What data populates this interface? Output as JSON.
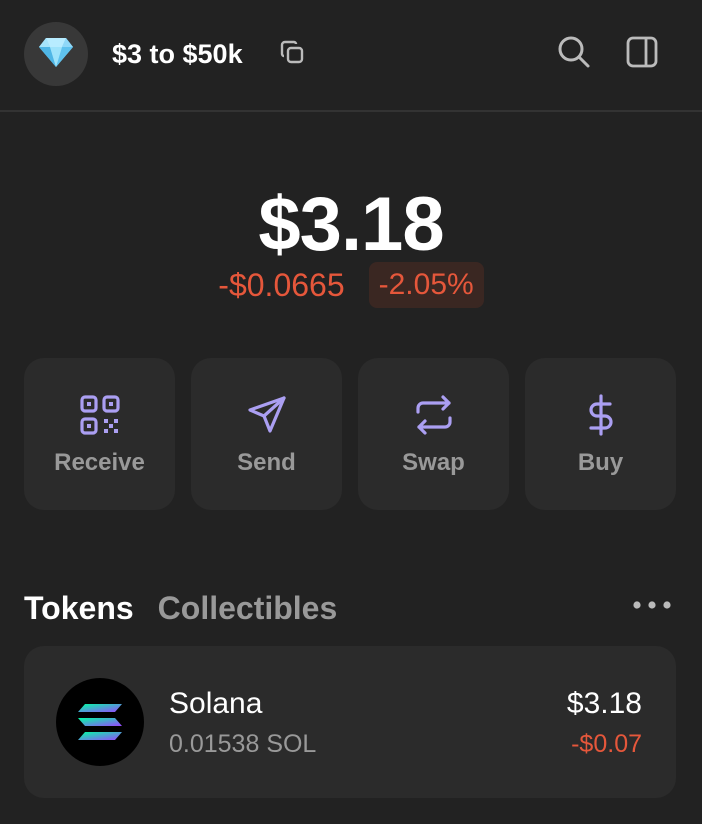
{
  "header": {
    "account_name": "$3 to $50k",
    "avatar_icon": "diamond-icon"
  },
  "balance": {
    "total": "$3.18",
    "change_amount": "-$0.0665",
    "change_percent": "-2.05%"
  },
  "actions": [
    {
      "label": "Receive",
      "icon": "qr-code-icon"
    },
    {
      "label": "Send",
      "icon": "send-icon"
    },
    {
      "label": "Swap",
      "icon": "swap-icon"
    },
    {
      "label": "Buy",
      "icon": "dollar-icon"
    }
  ],
  "tabs": {
    "tokens": "Tokens",
    "collectibles": "Collectibles"
  },
  "tokens": [
    {
      "name": "Solana",
      "amount": "0.01538 SOL",
      "value": "$3.18",
      "change": "-$0.07"
    }
  ],
  "colors": {
    "background": "#222222",
    "card": "#2b2b2b",
    "accent": "#ab9ff2",
    "negative": "#e5573b",
    "muted": "#999999"
  }
}
